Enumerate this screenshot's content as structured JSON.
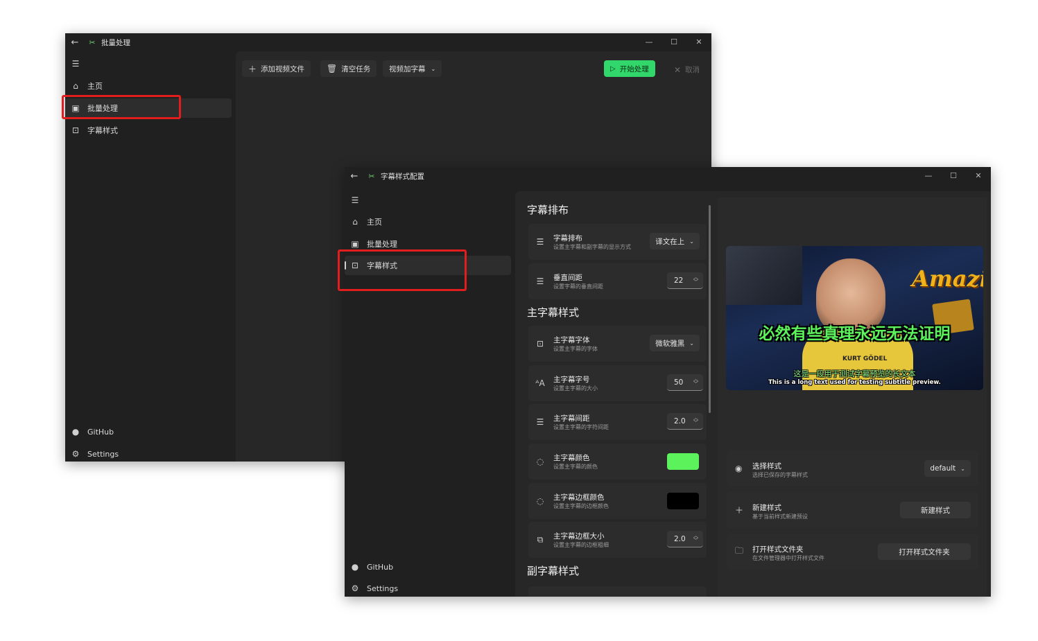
{
  "window1": {
    "title": "批量处理",
    "nav": {
      "home": "主页",
      "batch": "批量处理",
      "style": "字幕样式",
      "github": "GitHub",
      "settings": "Settings"
    },
    "toolbar": {
      "add_video": "添加视频文件",
      "clear_tasks": "清空任务",
      "mode": "视频加字幕",
      "start": "开始处理",
      "cancel": "取消"
    }
  },
  "window2": {
    "title": "字幕样式配置",
    "nav": {
      "home": "主页",
      "batch": "批量处理",
      "style": "字幕样式",
      "github": "GitHub",
      "settings": "Settings"
    },
    "sections": {
      "layout": "字幕排布",
      "main_style": "主字幕样式",
      "sub_style": "副字幕样式"
    },
    "settings": {
      "layout": {
        "title": "字幕排布",
        "desc": "设置主字幕和副字幕的显示方式",
        "value": "译文在上"
      },
      "vspace": {
        "title": "垂直间距",
        "desc": "设置字幕的垂直间距",
        "value": "22"
      },
      "font": {
        "title": "主字幕字体",
        "desc": "设置主字幕的字体",
        "value": "微软雅黑"
      },
      "size": {
        "title": "主字幕字号",
        "desc": "设置主字幕的大小",
        "value": "50"
      },
      "spacing": {
        "title": "主字幕间距",
        "desc": "设置主字幕的字符间距",
        "value": "2.0"
      },
      "color": {
        "title": "主字幕颜色",
        "desc": "设置主字幕的颜色",
        "value": "#5cf25c"
      },
      "border_color": {
        "title": "主字幕边框颜色",
        "desc": "设置主字幕的边框颜色",
        "value": "#000000"
      },
      "border_size": {
        "title": "主字幕边框大小",
        "desc": "设置主字幕的边框粗细",
        "value": "2.0"
      }
    },
    "preview": {
      "main_line": "必然有些真理永远无法证明",
      "sub_line_cn": "这是一段用于测试字幕预览的长文本",
      "sub_line_en": "This is a long text used for testing subtitle preview.",
      "word_art": "Amazin",
      "shirt": "KURT GÖDEL"
    },
    "right": {
      "select": {
        "title": "选择样式",
        "desc": "选择已保存的字幕样式",
        "value": "default"
      },
      "new": {
        "title": "新建样式",
        "desc": "基于当前样式新建预设",
        "button": "新建样式"
      },
      "open": {
        "title": "打开样式文件夹",
        "desc": "在文件管理器中打开样式文件",
        "button": "打开样式文件夹"
      }
    }
  },
  "colors": {
    "accent_green": "#31d76a",
    "highlight_red": "#e11d1d",
    "subtitle_green": "#5cf25c"
  }
}
